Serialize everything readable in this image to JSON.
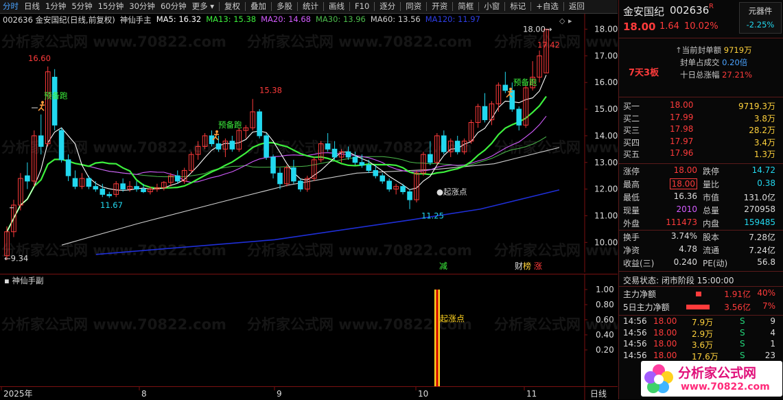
{
  "toolbar": {
    "items": [
      "分时",
      "日线",
      "1分钟",
      "5分钟",
      "15分钟",
      "30分钟",
      "60分钟",
      "更多",
      "复权",
      "叠加",
      "多股",
      "统计",
      "画线",
      "F10",
      "逐分",
      "同资",
      "开资",
      "简框",
      "小窗",
      "标记",
      "+自选",
      "返回"
    ]
  },
  "ma_bar": {
    "stock": "002636 金安国纪(日线,前复权)",
    "indicator": "神仙手主",
    "ma5": "MA5: 16.32",
    "ma13": "MA13: 15.38",
    "ma20": "MA20: 14.68",
    "ma30": "MA30: 13.96",
    "ma60": "MA60: 13.56",
    "ma120": "MA120: 11.97"
  },
  "colors": {
    "up": "#ff3b3b",
    "down": "#22d8ef",
    "ma5": "#ffffff",
    "ma13": "#3df03d",
    "ma20": "#d35cff",
    "ma30": "#4cbc4c",
    "ma60": "#d0d0d0",
    "ma120": "#1f2fd8"
  },
  "main_chart": {
    "price_axis": [
      "18.00",
      "17.00",
      "16.00",
      "15.00",
      "14.00",
      "13.00",
      "12.00",
      "11.00",
      "10.00"
    ],
    "annotations": {
      "high1": "16.60",
      "low1": "11.67",
      "high2": "15.38",
      "low2": "11.25",
      "start": "9.34",
      "last_high": "18.00",
      "last_close": "17.42",
      "signal1": "预备跑",
      "signal2": "预备跑",
      "signal3": "预备跑",
      "rise_point": "●起涨点",
      "tag_reduce": "减",
      "tag_cai": "财",
      "tag_bang": "榜",
      "tag_zhang": "涨"
    }
  },
  "sub_chart": {
    "title": "神仙手副",
    "axis": [
      "1.00",
      "0.80",
      "0.60",
      "0.40",
      "0.20"
    ],
    "signal_label": "起涨点"
  },
  "xaxis": {
    "labels": [
      "2025年",
      "8",
      "9",
      "10",
      "11"
    ],
    "right": "日线"
  },
  "watermark": "分析家公式网 www.70822.com",
  "right_panel": {
    "name": "金安国纪",
    "code": "002636",
    "r_badge": "R",
    "sector": "元器件",
    "sector_change": "-2.25%",
    "price": "18.00",
    "change": "1.64",
    "change_pct": "10.02%",
    "limit_label": "7天3板",
    "seal_label": "当前封单额",
    "seal_value": "9719万",
    "seal_ratio_label": "封单占成交",
    "seal_ratio_value": "0.20倍",
    "ten_day_label": "十日总涨幅",
    "ten_day_value": "27.21%",
    "order_book": [
      {
        "label": "买一",
        "price": "18.00",
        "vol": "9719.3万"
      },
      {
        "label": "买二",
        "price": "17.99",
        "vol": "3.8万"
      },
      {
        "label": "买三",
        "price": "17.98",
        "vol": "28.2万"
      },
      {
        "label": "买四",
        "price": "17.97",
        "vol": "3.4万"
      },
      {
        "label": "买五",
        "price": "17.96",
        "vol": "1.3万"
      }
    ],
    "stats": [
      {
        "l1": "涨停",
        "v1": "18.00",
        "l2": "跌停",
        "v2": "14.72"
      },
      {
        "l1": "最高",
        "v1": "18.00",
        "l2": "量比",
        "v2": "0.38"
      },
      {
        "l1": "最低",
        "v1": "16.36",
        "l2": "市值",
        "v2": "131.0亿"
      },
      {
        "l1": "现量",
        "v1": "2010",
        "l2": "总量",
        "v2": "270958"
      },
      {
        "l1": "外盘",
        "v1": "111473",
        "l2": "内盘",
        "v2": "159485"
      }
    ],
    "stats2": [
      {
        "l1": "换手",
        "v1": "3.74%",
        "l2": "股本",
        "v2": "7.28亿"
      },
      {
        "l1": "净资",
        "v1": "4.78",
        "l2": "流通",
        "v2": "7.24亿"
      },
      {
        "l1": "收益(三)",
        "v1": "0.240",
        "l2": "PE(动)",
        "v2": "56.8"
      }
    ],
    "trade_status": "交易状态: 闭市阶段 15:00:00",
    "flow": [
      {
        "label": "主力净额",
        "value": "1.91亿",
        "pct": "40%"
      },
      {
        "label": "5日主力净额",
        "value": "3.56亿",
        "pct": "7%"
      }
    ],
    "ticks": [
      {
        "time": "14:56",
        "price": "18.00",
        "vol": "7.9万",
        "side": "S",
        "n": "9"
      },
      {
        "time": "14:56",
        "price": "18.00",
        "vol": "2.9万",
        "side": "S",
        "n": "4"
      },
      {
        "time": "14:56",
        "price": "18.00",
        "vol": "3.6万",
        "side": "S",
        "n": "1"
      },
      {
        "time": "14:56",
        "price": "18.00",
        "vol": "17.6万",
        "side": "S",
        "n": "23"
      }
    ],
    "logo_text": "分析家公式网",
    "logo_url": "www.70822.com"
  }
}
